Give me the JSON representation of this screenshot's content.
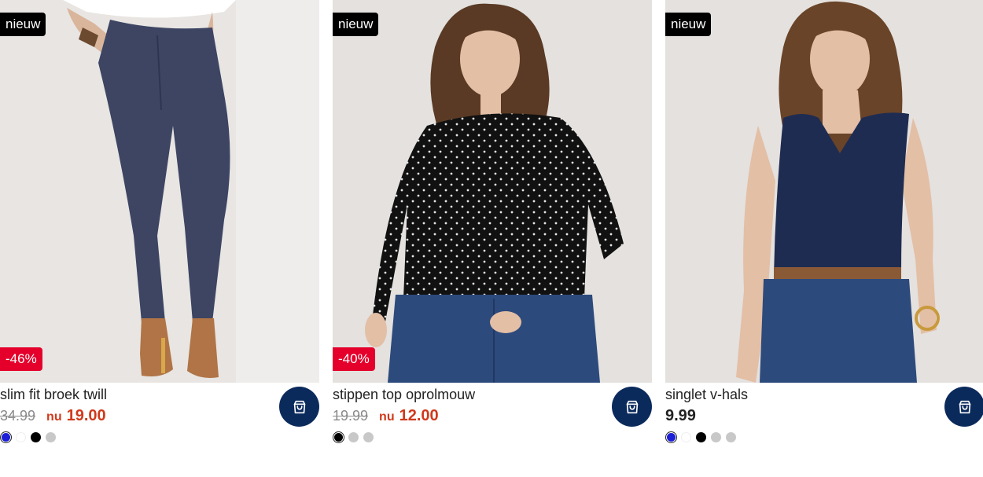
{
  "products": [
    {
      "badge_new": "nieuw",
      "badge_discount": "-46%",
      "title": "slim fit broek twill",
      "old_price": "34.99",
      "nu_label": "nu",
      "price": "19.00",
      "swatches": [
        "#1b1fd6",
        "#ffffff",
        "#000000",
        "#c8c8c8"
      ]
    },
    {
      "badge_new": "nieuw",
      "badge_discount": "-40%",
      "title": "stippen top oprolmouw",
      "old_price": "19.99",
      "nu_label": "nu",
      "price": "12.00",
      "swatches": [
        "#000000",
        "#c8c8c8",
        "#c8c8c8"
      ]
    },
    {
      "badge_new": "nieuw",
      "title": "singlet v-hals",
      "price": "9.99",
      "swatches": [
        "#1b1fd6",
        "#ffffff",
        "#000000",
        "#c8c8c8",
        "#c8c8c8"
      ]
    }
  ],
  "icons": {
    "cart": "shopping-bag-icon"
  },
  "colors": {
    "sale_red": "#d0391b",
    "badge_red": "#e4002b",
    "cart_navy": "#0b2a5c"
  }
}
